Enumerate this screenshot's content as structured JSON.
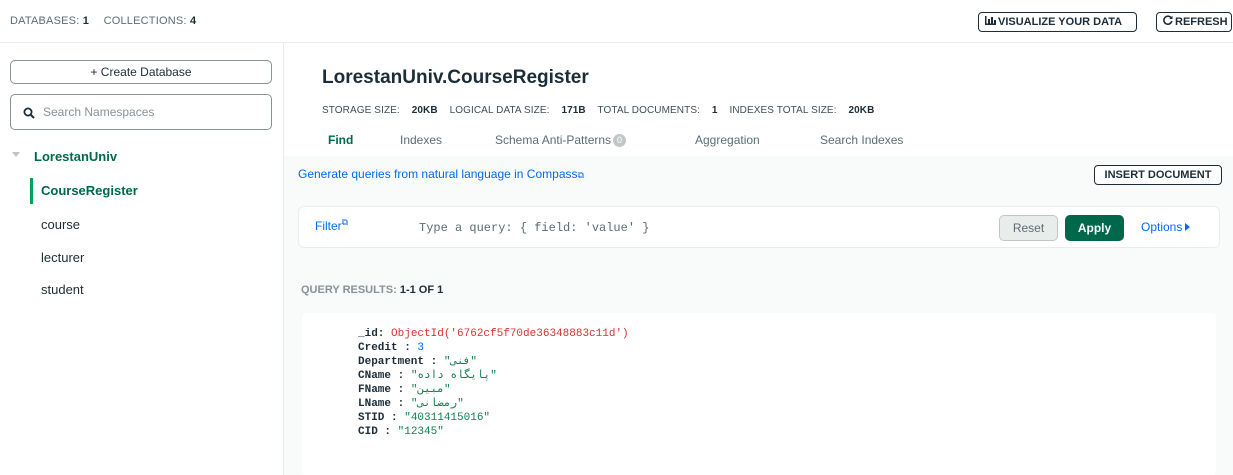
{
  "topbar": {
    "databases_label": "DATABASES:",
    "databases_count": "1",
    "collections_label": "COLLECTIONS:",
    "collections_count": "4",
    "visualize_label": "VISUALIZE YOUR DATA",
    "refresh_label": "REFRESH"
  },
  "sidebar": {
    "create_db_label": "+ Create Database",
    "search_placeholder": "Search Namespaces",
    "database": "LorestanUniv",
    "collections": [
      {
        "label": "CourseRegister",
        "active": true
      },
      {
        "label": "course",
        "active": false
      },
      {
        "label": "lecturer",
        "active": false
      },
      {
        "label": "student",
        "active": false
      }
    ]
  },
  "main": {
    "title": "LorestanUniv.CourseRegister",
    "stats": {
      "storage_label": "STORAGE SIZE:",
      "storage_value": "20KB",
      "logical_label": "LOGICAL DATA SIZE:",
      "logical_value": "171B",
      "docs_label": "TOTAL DOCUMENTS:",
      "docs_value": "1",
      "indexes_label": "INDEXES TOTAL SIZE:",
      "indexes_value": "20KB"
    },
    "tabs": [
      "Find",
      "Indexes",
      "Schema Anti-Patterns",
      "Aggregation",
      "Search Indexes"
    ],
    "schema_badge": "0",
    "nl_link": "Generate queries from natural language in Compass",
    "insert_label": "INSERT DOCUMENT",
    "filter_label": "Filter",
    "query_placeholder": "Type a query: { field: 'value' }",
    "reset_label": "Reset",
    "apply_label": "Apply",
    "options_label": "Options",
    "results_label": "QUERY RESULTS:",
    "results_range": "1-1 OF 1",
    "document": {
      "id_key": "_id:",
      "id_value": "ObjectId('6762cf5f70de36348883c11d')",
      "credit_key": "Credit :",
      "credit_value": "3",
      "department_key": "Department :",
      "department_value": "\"فنی\"",
      "cname_key": "CName :",
      "cname_value": "\"پایگاه داده\"",
      "fname_key": "FName :",
      "fname_value": "\"مبین\"",
      "lname_key": "LName :",
      "lname_value": "\"رمضانی\"",
      "stid_key": "STID :",
      "stid_value": "\"40311415016\"",
      "cid_key": "CID :",
      "cid_value": "\"12345\""
    }
  },
  "colors": {
    "accent_green": "#00684a",
    "link_blue": "#016bf8",
    "objectid_red": "#db3030"
  }
}
